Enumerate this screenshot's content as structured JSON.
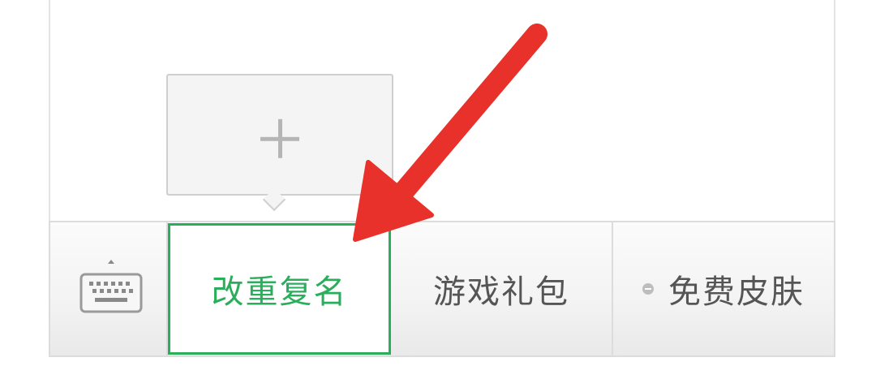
{
  "popup": {
    "icon": "plus-icon"
  },
  "menu": {
    "keyboard_icon": "keyboard-icon",
    "items": [
      {
        "label": "改重复名",
        "selected": true
      },
      {
        "label": "游戏礼包",
        "selected": false
      },
      {
        "label": "免费皮肤",
        "selected": false,
        "icon": "minus-circle-icon"
      }
    ]
  },
  "annotation": {
    "icon": "red-arrow-annotation",
    "color": "#e8312a"
  },
  "colors": {
    "selected_accent": "#2aae5c",
    "menu_text": "#555555",
    "border": "#dcdcdc"
  }
}
